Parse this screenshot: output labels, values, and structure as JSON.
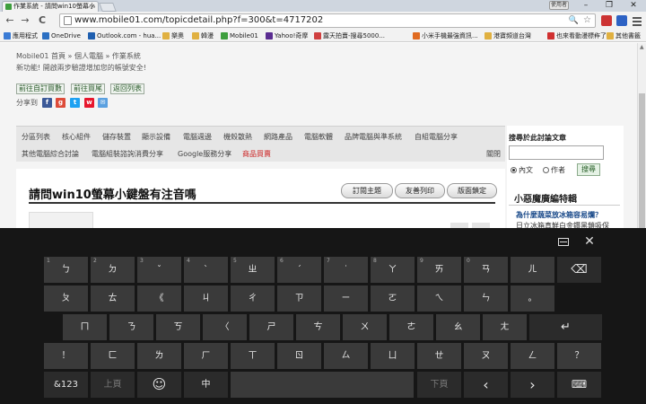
{
  "browser": {
    "tab_title": "作業系統 - 請問win10螢幕小",
    "tab_close": "×",
    "user_badge": "使用者",
    "win_min": "–",
    "win_max": "❐",
    "win_close": "✕",
    "url": "www.mobile01.com/topicdetail.php?f=300&t=4717202",
    "back": "←",
    "forward": "→",
    "reload": "C",
    "star": "☆",
    "zoom": "🔍"
  },
  "bookmarks": [
    {
      "label": "應用程式",
      "color": "#3a7bd5"
    },
    {
      "label": "OneDrive",
      "color": "#2b6fc2"
    },
    {
      "label": "Outlook.com - hua...",
      "color": "#1f5fb0"
    },
    {
      "label": "樂奧",
      "color": "#e0b040"
    },
    {
      "label": "韓漫",
      "color": "#e0b040"
    },
    {
      "label": "Mobile01",
      "color": "#3d9e3d"
    },
    {
      "label": "Yahoo!奇摩",
      "color": "#5a2d91"
    },
    {
      "label": "露天拍賣-搜尋5000...",
      "color": "#d04040"
    },
    {
      "label": "小米手機最強資訊...",
      "color": "#e06a20"
    },
    {
      "label": "港寶頻道台灣",
      "color": "#e0b040"
    },
    {
      "label": "也來看動漫標作了",
      "color": "#d03030"
    }
  ],
  "bookmarks_more": "»",
  "bookmarks_other": "其他書籤",
  "page": {
    "breadcrumb": "Mobile01 首頁 » 個人電腦 » 作業系統",
    "notice": "新功能! 開啟兩步驗證增加您的帳號安全!",
    "buttons": [
      "前往自訂買數",
      "前往買尾",
      "返回列表"
    ],
    "share_label": "分享到"
  },
  "categories_row1": [
    "分區列表",
    "核心組件",
    "儲存裝置",
    "顯示設備",
    "電腦週邊",
    "機殼散熱",
    "網路產品",
    "電腦軟體",
    "品牌電腦與準系統",
    "自組電腦分享"
  ],
  "categories_row2": [
    "其他電腦綜合討論",
    "電腦組裝諮詢消費分享",
    "Google服務分享",
    "商品買賣"
  ],
  "categories_close": "關閉",
  "thread": {
    "title": "請問win10螢幕小鍵盤有注音嗎",
    "btn_subscribe": "訂閱主題",
    "btn_print": "友善列印",
    "btn_lock": "版面鎖定"
  },
  "sidebar": {
    "search_title": "搜尋於此討論文章",
    "search_placeholder": "",
    "radio_content": "內文",
    "radio_author": "作者",
    "search_button": "搜尋",
    "promo_title": "小惡魔廣編特輯",
    "promo_link": "為什麼蔬菜放冰箱容易爛？",
    "promo_text": "日立冰箱真鮮白金鑽黑鎖吸保"
  },
  "keyboard": {
    "dock_label": "",
    "close": "✕",
    "row1": [
      {
        "num": "1",
        "label": "ㄅ"
      },
      {
        "num": "2",
        "label": "ㄉ"
      },
      {
        "num": "3",
        "label": "ˇ"
      },
      {
        "num": "4",
        "label": "ˋ"
      },
      {
        "num": "5",
        "label": "ㄓ"
      },
      {
        "num": "6",
        "label": "ˊ"
      },
      {
        "num": "7",
        "label": "˙"
      },
      {
        "num": "8",
        "label": "ㄚ"
      },
      {
        "num": "9",
        "label": "ㄞ"
      },
      {
        "num": "0",
        "label": "ㄢ"
      },
      {
        "num": "",
        "label": "ㄦ"
      }
    ],
    "backspace": "⌫",
    "row2": [
      "ㄆ",
      "ㄊ",
      "《",
      "ㄐ",
      "ㄔ",
      "ㄗ",
      "ㄧ",
      "ㄛ",
      "ㄟ",
      "ㄣ",
      "。"
    ],
    "row3": [
      "ㄇ",
      "ㄋ",
      "ㄎ",
      "〈",
      "ㄕ",
      "ㄘ",
      "ㄨ",
      "ㄜ",
      "ㄠ",
      "ㄤ"
    ],
    "enter": "↵",
    "row4": [
      "！",
      "ㄈ",
      "ㄌ",
      "ㄏ",
      "ㄒ",
      "ㄖ",
      "ㄙ",
      "ㄩ",
      "ㄝ",
      "ㄡ",
      "ㄥ",
      "？"
    ],
    "key_123": "&123",
    "key_prev": "上頁",
    "key_emoji": "☺",
    "key_lang": "中",
    "key_next": "下頁",
    "key_left": "‹",
    "key_right": "›",
    "key_kbd": "⌨"
  }
}
